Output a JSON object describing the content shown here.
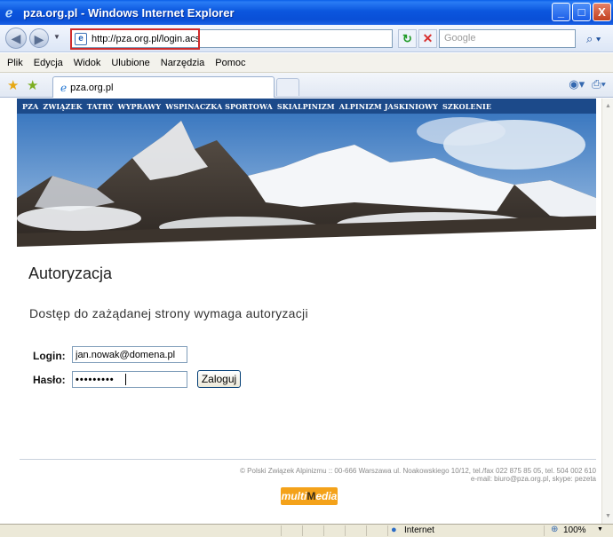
{
  "window": {
    "title": "pza.org.pl - Windows Internet Explorer",
    "buttons": {
      "minimize": "_",
      "maximize": "□",
      "close": "X"
    }
  },
  "address_bar": {
    "url": "http://pza.org.pl/login.acs"
  },
  "search": {
    "placeholder": "Google"
  },
  "menu": {
    "items": [
      "Plik",
      "Edycja",
      "Widok",
      "Ulubione",
      "Narzędzia",
      "Pomoc"
    ]
  },
  "tab": {
    "label": "pza.org.pl"
  },
  "site_nav": {
    "items": [
      "PZA",
      "ZWIĄZEK",
      "TATRY",
      "WYPRAWY",
      "WSPINACZKA SPORTOWA",
      "SKIALPINIZM",
      "ALPINIZM JASKINIOWY",
      "SZKOLENIE"
    ]
  },
  "page": {
    "title": "Autoryzacja",
    "message": "Dostęp do zażądanej strony wymaga autoryzacji"
  },
  "form": {
    "login_label": "Login:",
    "login_value": "jan.nowak@domena.pl",
    "password_label": "Hasło:",
    "password_mask": "•••••••••",
    "submit_label": "Zaloguj"
  },
  "footer": {
    "line1": "© Polski Związek Alpinizmu :: 00-666 Warszawa ul. Noakowskiego 10/12, tel./fax 022 875 85 05, tel. 504 002 610",
    "line2": "e-mail: biuro@pza.org.pl, skype: pezeta",
    "logo_left": "multi",
    "logo_mid": "M",
    "logo_right": "edia"
  },
  "status": {
    "zone": "Internet",
    "zoom": "100%"
  },
  "colors": {
    "site_nav_bg": "#1c4a8a",
    "titlebar": "#0b56de",
    "highlight_box": "#d12b2b",
    "logo_bg": "#f4a21a"
  }
}
